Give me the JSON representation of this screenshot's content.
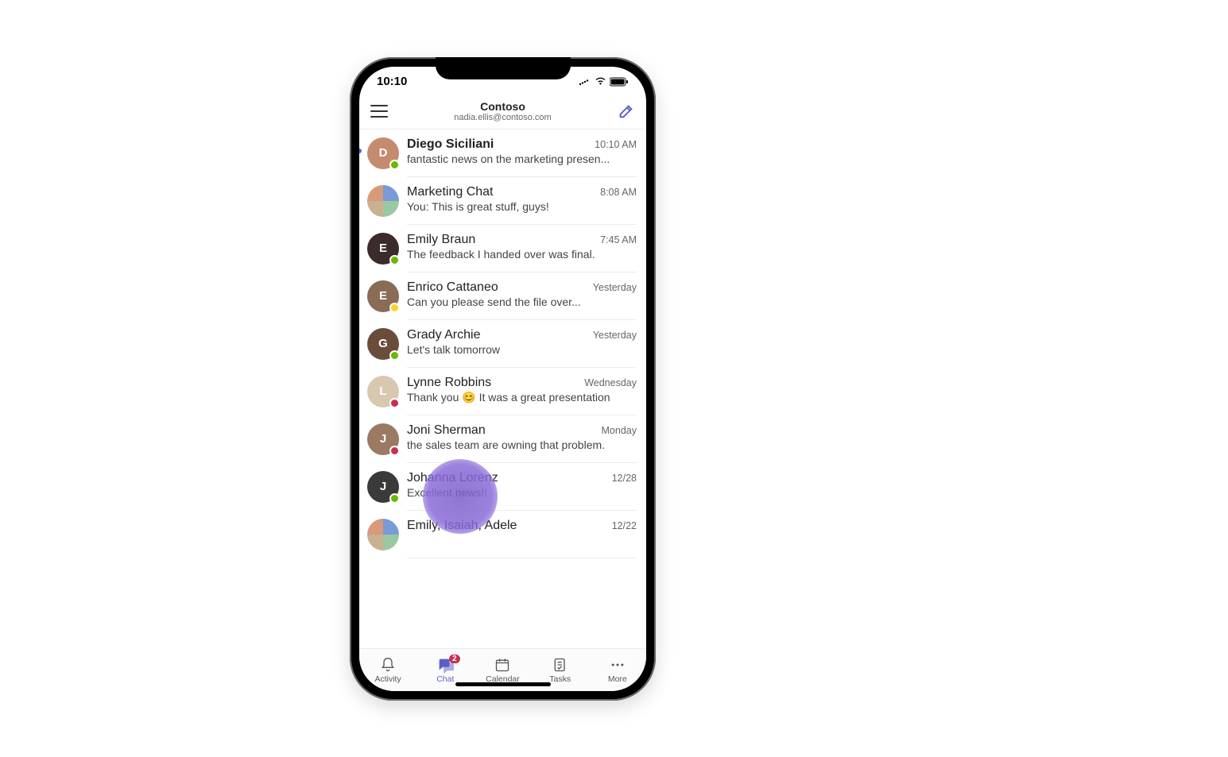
{
  "status": {
    "time": "10:10"
  },
  "header": {
    "org": "Contoso",
    "email": "nadia.ellis@contoso.com"
  },
  "chats": [
    {
      "name": "Diego Siciliani",
      "time": "10:10 AM",
      "preview": "fantastic news on the marketing presen...",
      "unread": true,
      "presence": "available",
      "avatarColor": "#c58b6e"
    },
    {
      "name": "Marketing Chat",
      "time": "8:08 AM",
      "preview": "You: This is great stuff, guys!",
      "unread": false,
      "presence": "",
      "group": true
    },
    {
      "name": "Emily Braun",
      "time": "7:45 AM",
      "preview": "The feedback I handed over was final.",
      "unread": false,
      "presence": "available",
      "avatarColor": "#3b2b2b"
    },
    {
      "name": "Enrico Cattaneo",
      "time": "Yesterday",
      "preview": "Can you please send the file over...",
      "unread": false,
      "presence": "away",
      "avatarColor": "#8a6b55"
    },
    {
      "name": "Grady Archie",
      "time": "Yesterday",
      "preview": "Let's talk tomorrow",
      "unread": false,
      "presence": "available",
      "avatarColor": "#6b4c3a"
    },
    {
      "name": "Lynne Robbins",
      "time": "Wednesday",
      "preview": "Thank you 😊 It was a great presentation",
      "unread": false,
      "presence": "dnd",
      "avatarColor": "#d8c8b0"
    },
    {
      "name": "Joni Sherman",
      "time": "Monday",
      "preview": "the sales team are owning that problem.",
      "unread": false,
      "presence": "dnd",
      "avatarColor": "#9a7a62"
    },
    {
      "name": "Johanna Lorenz",
      "time": "12/28",
      "preview": "Excellent news!!",
      "unread": false,
      "presence": "available",
      "avatarColor": "#3a3a3a"
    },
    {
      "name": "Emily, Isaiah, Adele",
      "time": "12/22",
      "preview": "",
      "unread": false,
      "presence": "",
      "group": true
    }
  ],
  "tabs": {
    "activity": "Activity",
    "chat": "Chat",
    "calendar": "Calendar",
    "tasks": "Tasks",
    "more": "More",
    "chat_badge": "2"
  }
}
